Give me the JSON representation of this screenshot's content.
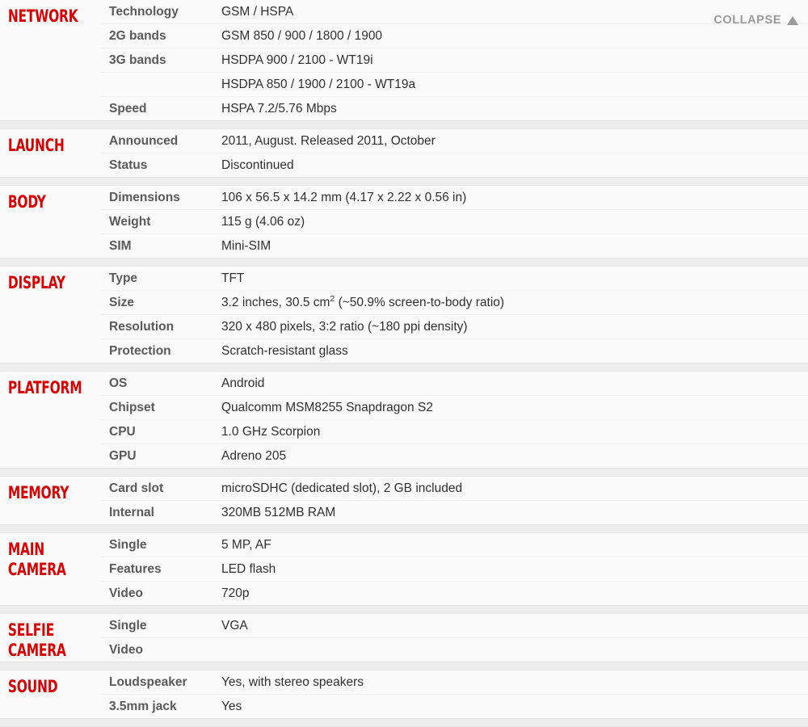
{
  "collapse": {
    "label": "COLLAPSE",
    "icon": "triangle-up-icon"
  },
  "colors": {
    "heading_red": "#d80000",
    "label_gray": "#5a5a5a",
    "value_dark": "#303030",
    "row_bg": "#fafafa",
    "section_gap": "#ededed"
  },
  "sections": [
    {
      "title": "NETWORK",
      "rows": [
        {
          "label": "Technology",
          "value": "GSM / HSPA"
        },
        {
          "label": "2G bands",
          "value": "GSM 850 / 900 / 1800 / 1900"
        },
        {
          "label": "3G bands",
          "value": "HSDPA 900 / 2100 - WT19i"
        },
        {
          "label": "",
          "value": "HSDPA 850 / 1900 / 2100 - WT19a",
          "continuation": true
        },
        {
          "label": "Speed",
          "value": "HSPA 7.2/5.76 Mbps"
        }
      ]
    },
    {
      "title": "LAUNCH",
      "rows": [
        {
          "label": "Announced",
          "value": "2011, August. Released 2011, October"
        },
        {
          "label": "Status",
          "value": "Discontinued"
        }
      ]
    },
    {
      "title": "BODY",
      "rows": [
        {
          "label": "Dimensions",
          "value": "106 x 56.5 x 14.2 mm (4.17 x 2.22 x 0.56 in)"
        },
        {
          "label": "Weight",
          "value": "115 g (4.06 oz)"
        },
        {
          "label": "SIM",
          "value": "Mini-SIM"
        }
      ]
    },
    {
      "title": "DISPLAY",
      "rows": [
        {
          "label": "Type",
          "value": "TFT"
        },
        {
          "label": "Size",
          "value_html": "3.2 inches, 30.5 cm<sup>2</sup> (~50.9% screen-to-body ratio)",
          "value": "3.2 inches, 30.5 cm2 (~50.9% screen-to-body ratio)"
        },
        {
          "label": "Resolution",
          "value": "320 x 480 pixels, 3:2 ratio (~180 ppi density)"
        },
        {
          "label": "Protection",
          "value": "Scratch-resistant glass"
        }
      ]
    },
    {
      "title": "PLATFORM",
      "rows": [
        {
          "label": "OS",
          "value": "Android"
        },
        {
          "label": "Chipset",
          "value": "Qualcomm MSM8255 Snapdragon S2"
        },
        {
          "label": "CPU",
          "value": "1.0 GHz Scorpion"
        },
        {
          "label": "GPU",
          "value": "Adreno 205"
        }
      ]
    },
    {
      "title": "MEMORY",
      "rows": [
        {
          "label": "Card slot",
          "value": "microSDHC (dedicated slot), 2 GB included"
        },
        {
          "label": "Internal",
          "value": "320MB 512MB RAM"
        }
      ]
    },
    {
      "title": "MAIN\nCAMERA",
      "rows": [
        {
          "label": "Single",
          "value": "5 MP, AF"
        },
        {
          "label": "Features",
          "value": "LED flash"
        },
        {
          "label": "Video",
          "value": "720p"
        }
      ]
    },
    {
      "title": "SELFIE\nCAMERA",
      "rows": [
        {
          "label": "Single",
          "value": "VGA"
        },
        {
          "label": "Video",
          "value": ""
        }
      ]
    },
    {
      "title": "SOUND",
      "rows": [
        {
          "label": "Loudspeaker",
          "value": "Yes, with stereo speakers"
        },
        {
          "label": "3.5mm jack",
          "value": "Yes"
        }
      ]
    }
  ]
}
